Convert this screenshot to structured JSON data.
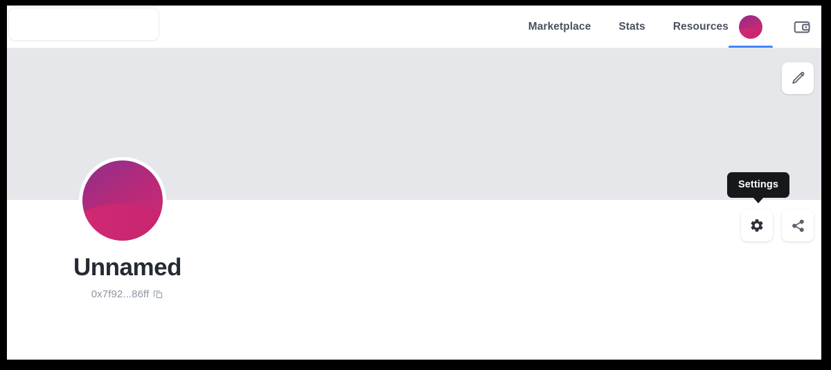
{
  "header": {
    "logo_placeholder": "",
    "nav_items": [
      {
        "label": "Marketplace",
        "name": "nav-marketplace"
      },
      {
        "label": "Stats",
        "name": "nav-stats"
      },
      {
        "label": "Resources",
        "name": "nav-resources"
      }
    ],
    "avatar_icon": "profile-avatar-blob",
    "wallet_icon": "wallet-icon",
    "active_indicator_color": "#4285f4"
  },
  "banner": {
    "background_color": "#e5e7eb",
    "edit_icon": "pencil-icon"
  },
  "profile": {
    "avatar_icon": "profile-avatar-blob",
    "name": "Unnamed",
    "address": "0x7f92...86ff",
    "copy_icon": "copy-icon"
  },
  "actions": {
    "settings_icon": "gear-icon",
    "share_icon": "share-icon",
    "tooltip_label": "Settings",
    "tooltip_background": "#17181a"
  },
  "colors": {
    "accent_blue": "#4285f4",
    "avatar_gradient_start": "#8e2f8c",
    "avatar_gradient_end": "#d62b6f",
    "text_primary": "#252a33",
    "text_muted": "#8d94a1",
    "nav_text": "#4a5160"
  }
}
